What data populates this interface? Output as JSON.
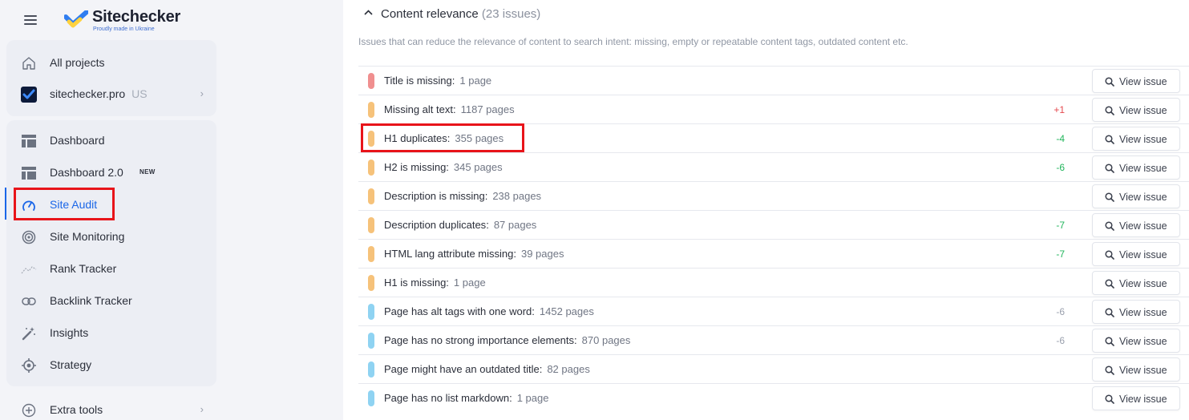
{
  "brand": {
    "name": "Sitechecker",
    "tagline": "Proudly made in Ukraine"
  },
  "sidebar": {
    "top_items": [
      {
        "label": "All projects",
        "icon": "home-icon"
      },
      {
        "label": "sitechecker.pro",
        "country": "US",
        "icon": "project-logo-icon",
        "has_chevron": true
      }
    ],
    "items": [
      {
        "label": "Dashboard",
        "icon": "dashboard-icon"
      },
      {
        "label": "Dashboard 2.0",
        "badge": "NEW",
        "icon": "dashboard-icon"
      },
      {
        "label": "Site Audit",
        "icon": "speedometer-icon",
        "active": true
      },
      {
        "label": "Site Monitoring",
        "icon": "radar-icon"
      },
      {
        "label": "Rank Tracker",
        "icon": "trend-line-icon"
      },
      {
        "label": "Backlink Tracker",
        "icon": "link-icon"
      },
      {
        "label": "Insights",
        "icon": "magic-wand-icon"
      },
      {
        "label": "Strategy",
        "icon": "target-icon"
      }
    ],
    "extra": {
      "label": "Extra tools",
      "icon": "plus-circle-icon"
    }
  },
  "section": {
    "title": "Content relevance",
    "count": "(23 issues)",
    "description": "Issues that can reduce the relevance of content to search intent: missing, empty or repeatable content tags, outdated content etc.",
    "view_label": "View issue",
    "colors": {
      "error": "#f08f8f",
      "warning": "#f6c27a",
      "notice": "#8fd3f2",
      "up": "#e5484d",
      "down": "#22b55c",
      "neutral": "#9aa0ad"
    },
    "issues": [
      {
        "name": "Title is missing",
        "pages": "1 page",
        "level": "error",
        "delta": "",
        "trend": ""
      },
      {
        "name": "Missing alt text",
        "pages": "1187 pages",
        "level": "warning",
        "delta": "+1",
        "trend": "up"
      },
      {
        "name": "H1 duplicates",
        "pages": "355 pages",
        "level": "warning",
        "delta": "-4",
        "trend": "down"
      },
      {
        "name": "H2 is missing",
        "pages": "345 pages",
        "level": "warning",
        "delta": "-6",
        "trend": "down"
      },
      {
        "name": "Description is missing",
        "pages": "238 pages",
        "level": "warning",
        "delta": "",
        "trend": ""
      },
      {
        "name": "Description duplicates",
        "pages": "87 pages",
        "level": "warning",
        "delta": "-7",
        "trend": "down"
      },
      {
        "name": "HTML lang attribute missing",
        "pages": "39 pages",
        "level": "warning",
        "delta": "-7",
        "trend": "down"
      },
      {
        "name": "H1 is missing",
        "pages": "1 page",
        "level": "warning",
        "delta": "",
        "trend": ""
      },
      {
        "name": "Page has alt tags with one word",
        "pages": "1452 pages",
        "level": "notice",
        "delta": "-6",
        "trend": "neutral"
      },
      {
        "name": "Page has no strong importance elements",
        "pages": "870 pages",
        "level": "notice",
        "delta": "-6",
        "trend": "neutral"
      },
      {
        "name": "Page might have an outdated title",
        "pages": "82 pages",
        "level": "notice",
        "delta": "",
        "trend": ""
      },
      {
        "name": "Page has no list markdown",
        "pages": "1 page",
        "level": "notice",
        "delta": "",
        "trend": ""
      }
    ]
  }
}
